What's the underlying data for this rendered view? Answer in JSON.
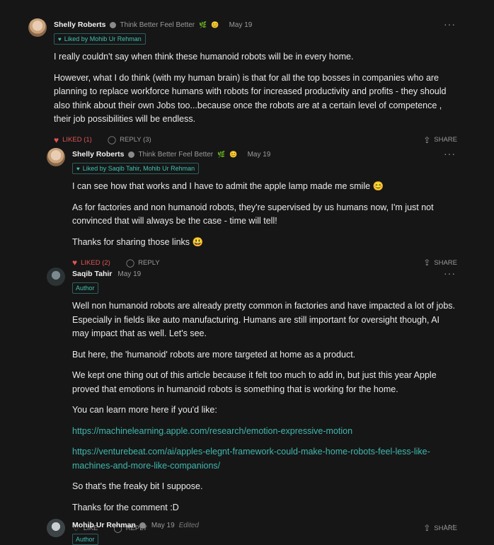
{
  "comments": [
    {
      "author": "Shelly Roberts",
      "tagline": "Think Better Feel Better",
      "date": "May 19",
      "liked_by": "Liked by Mohib Ur Rehman",
      "paragraphs": [
        "I really couldn't say when think these humanoid robots will be in every home.",
        "However, what I do think (with my human brain) is that for all the top bosses in companies who are planning to replace workforce humans with robots for increased productivity and profits - they should also think about their own Jobs too...because once the robots are at a certain level of competence , their job possibilities will be endless."
      ],
      "like_label": "LIKED (1)",
      "reply_label": "REPLY (3)",
      "share_label": "SHARE"
    },
    {
      "author": "Shelly Roberts",
      "tagline": "Think Better Feel Better",
      "date": "May 19",
      "liked_by": "Liked by Saqib Tahir, Mohib Ur Rehman",
      "paragraphs": [
        "I can see how that works and I have to admit the apple lamp made me smile 😊",
        "As for factories and non humanoid robots, they're supervised by us humans now, I'm just not convinced that will always be the case - time will tell!",
        "Thanks for sharing those links 😃"
      ],
      "like_label": "LIKED (2)",
      "reply_label": "REPLY",
      "share_label": "SHARE"
    },
    {
      "author": "Saqib Tahir",
      "date": "May 19",
      "role": "Author",
      "paragraphs": [
        "Well non humanoid robots are already pretty common in factories and have impacted a lot of jobs. Especially in fields like auto manufacturing. Humans are still important for oversight though, AI may impact that as well. Let's see.",
        "But here, the 'humanoid' robots are more targeted at home as a product.",
        "We kept one thing out of this article because it felt too much to add in, but just this year Apple proved that emotions in humanoid robots is something that is working for the home.",
        "You can learn more here if you'd like:"
      ],
      "links": [
        "https://machinelearning.apple.com/research/emotion-expressive-motion",
        "https://venturebeat.com/ai/apples-elegnt-framework-could-make-home-robots-feel-less-like-machines-and-more-like-companions/"
      ],
      "closing": [
        "So that's the freaky bit I suppose.",
        "Thanks for the comment :D"
      ],
      "like_label": "LIKE",
      "reply_label": "REPLY",
      "share_label": "SHARE"
    },
    {
      "author": "Mohib Ur Rehman",
      "date": "May 19",
      "edited": "Edited",
      "role": "Author"
    }
  ],
  "icons": {
    "more": "ellipsis-icon",
    "heart": "heart-icon",
    "reply": "speech-bubble-icon",
    "share": "share-icon",
    "verified": "verified-badge-icon"
  },
  "colors": {
    "background": "#161616",
    "accent": "#3fb8ae",
    "liked": "#e05555"
  }
}
